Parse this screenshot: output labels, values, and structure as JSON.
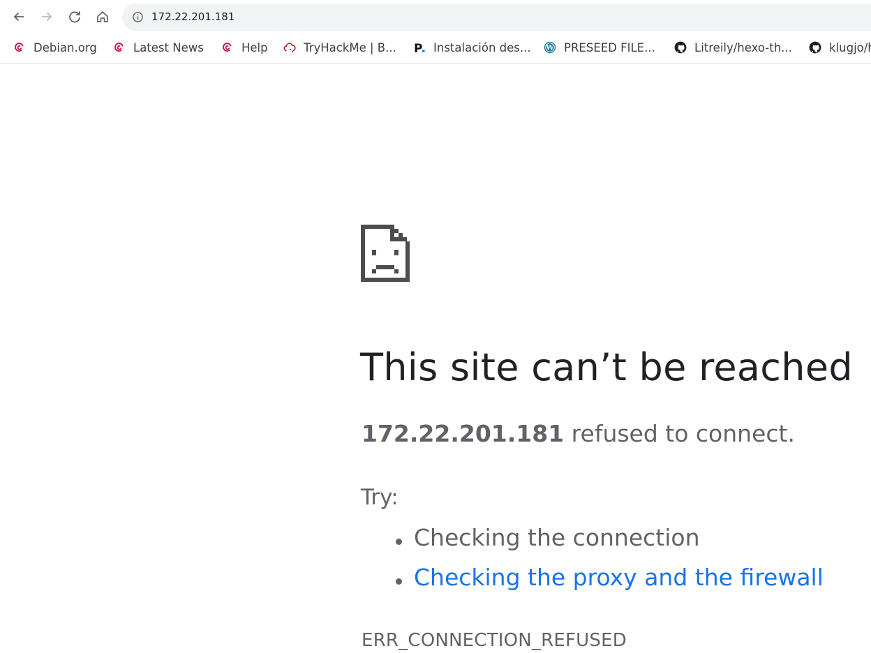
{
  "toolbar": {
    "back_icon": "arrow-left-icon",
    "forward_icon": "arrow-right-icon",
    "reload_icon": "reload-icon",
    "home_icon": "home-icon",
    "address": "172.22.201.181"
  },
  "bookmarks": [
    {
      "label": "Debian.org",
      "icon": "debian-icon"
    },
    {
      "label": "Latest News",
      "icon": "debian-icon"
    },
    {
      "label": "Help",
      "icon": "debian-icon"
    },
    {
      "label": "TryHackMe | B...",
      "icon": "tryhackme-icon"
    },
    {
      "label": "Instalación des...",
      "icon": "p-letter-icon"
    },
    {
      "label": "PRESEED FILE...",
      "icon": "wordpress-icon"
    },
    {
      "label": "Litreily/hexo-th...",
      "icon": "github-icon"
    },
    {
      "label": "klugjo/h",
      "icon": "github-icon"
    }
  ],
  "error": {
    "icon": "sad-document-icon",
    "heading": "This site can’t be reached",
    "host": "172.22.201.181",
    "message": " refused to connect.",
    "try_label": "Try:",
    "suggestions": [
      "Checking the connection",
      "Checking the proxy and the firewall"
    ],
    "code": "ERR_CONNECTION_REFUSED"
  },
  "colors": {
    "link": "#1a73e8",
    "text_secondary": "#5f6368",
    "debian_red": "#d70a53",
    "omnibox_bg": "#f1f3f4"
  }
}
